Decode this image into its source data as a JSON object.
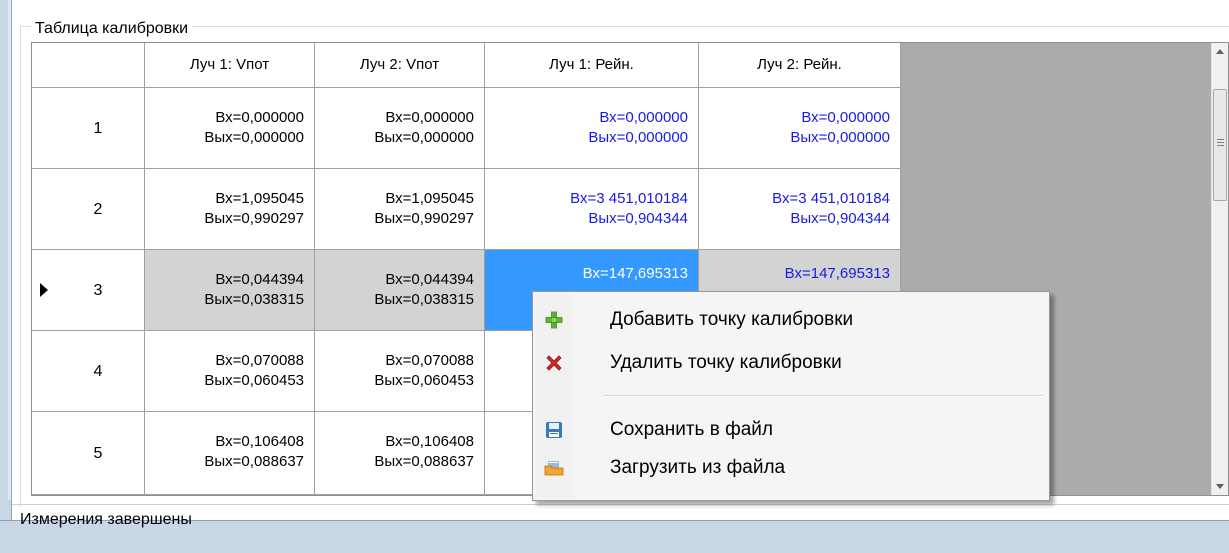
{
  "group": {
    "title": "Таблица калибровки"
  },
  "grid": {
    "columns": [
      "Луч 1: Vпот",
      "Луч 2: Vпот",
      "Луч 1: Рейн.",
      "Луч 2: Рейн."
    ],
    "rows": [
      {
        "num": "1",
        "c1": [
          "Вх=0,000000",
          "Вых=0,000000"
        ],
        "c2": [
          "Вх=0,000000",
          "Вых=0,000000"
        ],
        "c3": [
          "Вх=0,000000",
          "Вых=0,000000"
        ],
        "c4": [
          "Вх=0,000000",
          "Вых=0,000000"
        ]
      },
      {
        "num": "2",
        "c1": [
          "Вх=1,095045",
          "Вых=0,990297"
        ],
        "c2": [
          "Вх=1,095045",
          "Вых=0,990297"
        ],
        "c3": [
          "Вх=3 451,010184",
          "Вых=0,904344"
        ],
        "c4": [
          "Вх=3 451,010184",
          "Вых=0,904344"
        ]
      },
      {
        "num": "3",
        "c1": [
          "Вх=0,044394",
          "Вых=0,038315"
        ],
        "c2": [
          "Вх=0,044394",
          "Вых=0,038315"
        ],
        "c3": [
          "Вх=147,695313",
          ""
        ],
        "c4": [
          "Вх=147,695313",
          ""
        ]
      },
      {
        "num": "4",
        "c1": [
          "Вх=0,070088",
          "Вых=0,060453"
        ],
        "c2": [
          "Вх=0,070088",
          "Вых=0,060453"
        ]
      },
      {
        "num": "5",
        "c1": [
          "Вх=0,106408",
          "Вых=0,088637"
        ],
        "c2": [
          "Вх=0,106408",
          "Вых=0,088637"
        ]
      }
    ],
    "current_row": 3,
    "blue_text_color": "#1a1ae6",
    "selection_color": "#3399ff"
  },
  "context_menu": {
    "items": [
      {
        "label": "Добавить точку калибровки",
        "icon": "plus-icon"
      },
      {
        "label": "Удалить точку калибровки",
        "icon": "delete-x-icon"
      },
      {
        "label": "Сохранить в файл",
        "icon": "save-disk-icon"
      },
      {
        "label": "Загрузить из файла",
        "icon": "load-folder-icon"
      }
    ]
  },
  "status": {
    "text": "Измерения завершены"
  }
}
